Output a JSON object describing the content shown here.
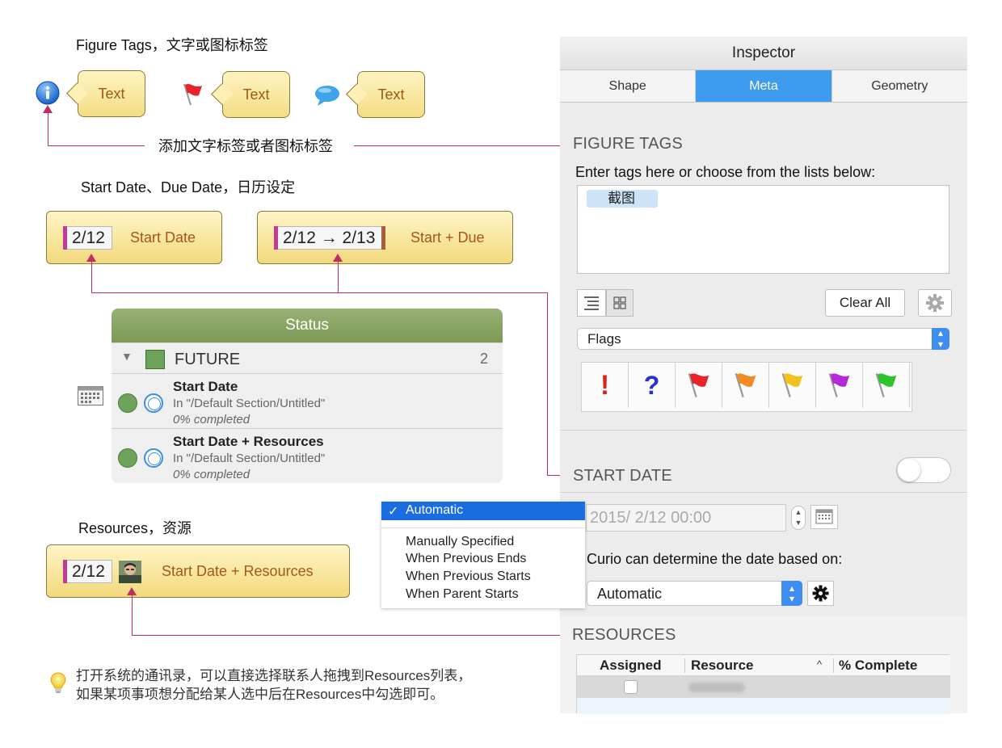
{
  "captions": {
    "figure_tags": "Figure Tags，文字或图标标签",
    "add_tag_note": "添加文字标签或者图标标签",
    "dates": "Start Date、Due Date，日历设定",
    "resources": "Resources，资源"
  },
  "tags": [
    {
      "icon": "info-icon",
      "label": "Text"
    },
    {
      "icon": "red-flag-icon",
      "label": "Text"
    },
    {
      "icon": "speech-bubble-icon",
      "label": "Text"
    }
  ],
  "date_cards": {
    "start": {
      "date": "2/12",
      "label": "Start Date"
    },
    "start_due": {
      "date": "2/12 → 2/13",
      "label": "Start + Due"
    },
    "resources": {
      "date": "2/12",
      "label": "Start Date + Resources"
    }
  },
  "status": {
    "header": "Status",
    "group": {
      "name": "FUTURE",
      "count": "2"
    },
    "rows": [
      {
        "title": "Start Date",
        "path": "In \"/Default Section/Untitled\"",
        "progress": "0% completed"
      },
      {
        "title": "Start Date + Resources",
        "path": "In \"/Default Section/Untitled\"",
        "progress": "0% completed"
      }
    ]
  },
  "inspector": {
    "title": "Inspector",
    "tabs": [
      "Shape",
      "Meta",
      "Geometry"
    ],
    "active_tab": "Meta",
    "figure_tags": {
      "title": "FIGURE TAGS",
      "prompt": "Enter tags here or choose from the lists below:",
      "tag": "截图",
      "clear_all": "Clear All",
      "list_select": "Flags"
    },
    "start_date": {
      "title": "START DATE",
      "toggle_on": false,
      "date_value": "2015/  2/12 00:00",
      "note": "Curio can determine the date based on:",
      "mode_select": "Automatic"
    },
    "resources": {
      "title": "RESOURCES",
      "columns": [
        "Assigned",
        "Resource",
        "% Complete"
      ]
    }
  },
  "date_mode_menu": {
    "selected": "Automatic",
    "check": "✓",
    "options": [
      "Manually Specified",
      "When Previous Ends",
      "When Previous Starts",
      "When Parent Starts"
    ]
  },
  "tip": {
    "line1": "打开系统的通讯录，可以直接选择联系人拖拽到Resources列表，",
    "line2": "如果某项事项想分配给某人选中后在Resources中勾选即可。"
  },
  "colors": {
    "accent_blue": "#3d9bf0",
    "connector": "#c02c64",
    "status_green": "#7d9a57",
    "card_text": "#a6561a"
  }
}
